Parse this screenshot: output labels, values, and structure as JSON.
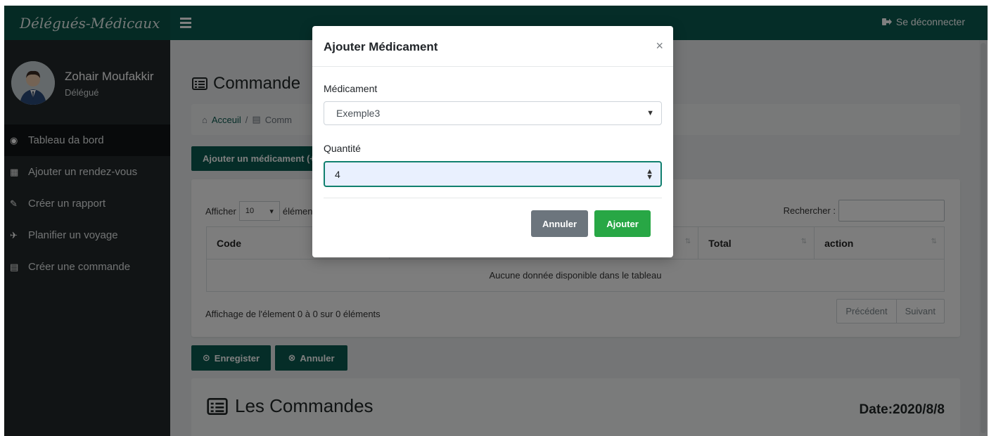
{
  "app": {
    "brand": "Délégués-Médicaux",
    "logout_label": "Se déconnecter"
  },
  "user": {
    "name": "Zohair Moufakkir",
    "role": "Délégué"
  },
  "sidebar": {
    "items": [
      {
        "label": "Tableau da bord",
        "icon": "dashboard-icon",
        "active": true
      },
      {
        "label": "Ajouter un rendez-vous",
        "icon": "calendar-plus-icon",
        "active": false
      },
      {
        "label": "Créer un rapport",
        "icon": "edit-icon",
        "active": false
      },
      {
        "label": "Planifier un voyage",
        "icon": "plane-icon",
        "active": false
      },
      {
        "label": "Créer une commande",
        "icon": "list-alt-icon",
        "active": false
      }
    ]
  },
  "page": {
    "title": "Commande",
    "breadcrumb": {
      "home": "Acceuil",
      "separator": "/",
      "current": "Comm"
    },
    "add_button": "Ajouter un médicament (+)"
  },
  "datatable": {
    "show_label": "Afficher",
    "page_size": "10",
    "entries_label": "éléments",
    "search_label": "Rechercher :",
    "columns": [
      "Code",
      "Total",
      "action"
    ],
    "empty_message": "Aucune donnée disponible dans le tableau",
    "info": "Affichage de l'élement 0 à 0 sur 0 éléments",
    "prev_label": "Précédent",
    "next_label": "Suivant"
  },
  "actions": {
    "save_label": "Enregister",
    "cancel_label": "Annuler"
  },
  "orders": {
    "title": "Les Commandes",
    "date": "Date:2020/8/8"
  },
  "modal": {
    "title": "Ajouter Médicament",
    "close_symbol": "×",
    "medicament_label": "Médicament",
    "medicament_value": "Exemple3",
    "quantite_label": "Quantité",
    "quantite_value": "4",
    "cancel_label": "Annuler",
    "submit_label": "Ajouter"
  },
  "colors": {
    "primary": "#0b5b50",
    "sidebar": "#22292b",
    "success": "#28a745",
    "secondary": "#6c757d"
  }
}
